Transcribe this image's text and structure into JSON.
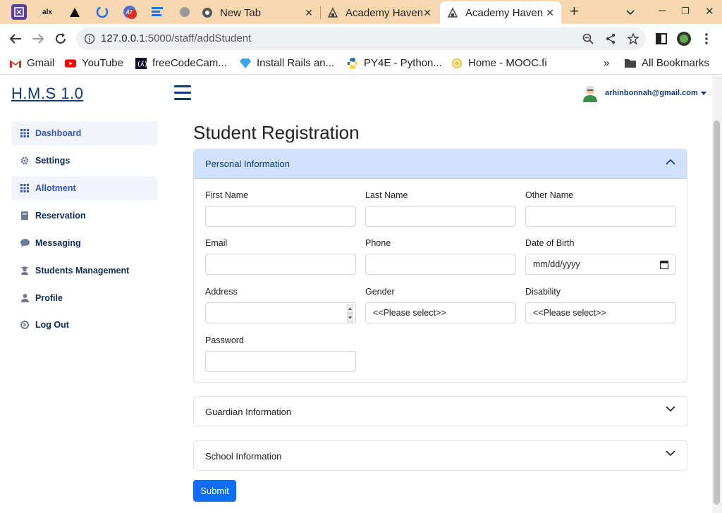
{
  "browser": {
    "tabs": [
      {
        "title": "New Tab"
      },
      {
        "title": "Academy Haven"
      },
      {
        "title": "Academy Haven"
      }
    ],
    "pinned_badge": "47",
    "url_host": "127.0.0.1",
    "url_rest": ":5000/staff/addStudent",
    "bookmarks": [
      "Gmail",
      "YouTube",
      "freeCodeCam...",
      "Install Rails an...",
      "PY4E - Python...",
      "Home - MOOC.fi"
    ],
    "overflow": "»",
    "all_bookmarks": "All Bookmarks"
  },
  "app": {
    "brand": "H.M.S 1.0",
    "user_email": "arhinbonnah@gmail.com",
    "sidebar": [
      {
        "label": "Dashboard",
        "icon": "grid-icon"
      },
      {
        "label": "Settings",
        "icon": "gear-icon"
      },
      {
        "label": "Allotment",
        "icon": "grid-icon"
      },
      {
        "label": "Reservation",
        "icon": "book-icon"
      },
      {
        "label": "Messaging",
        "icon": "chat-icon"
      },
      {
        "label": "Students Management",
        "icon": "student-icon"
      },
      {
        "label": "Profile",
        "icon": "user-icon"
      },
      {
        "label": "Log Out",
        "icon": "logout-icon"
      }
    ]
  },
  "form": {
    "title": "Student Registration",
    "sections": {
      "personal": "Personal Information",
      "guardian": "Guardian Information",
      "school": "School Information"
    },
    "fields": {
      "first_name": "First Name",
      "last_name": "Last Name",
      "other_name": "Other Name",
      "email": "Email",
      "phone": "Phone",
      "dob": "Date of Birth",
      "dob_placeholder": "mm/dd/yyyy",
      "address": "Address",
      "gender": "Gender",
      "gender_value": "<<Please select>>",
      "disability": "Disability",
      "disability_value": "<<Please select>>",
      "password": "Password"
    },
    "submit": "Submit"
  },
  "colors": {
    "tabstrip": "#f6d8b0",
    "brand": "#0d3b7c",
    "accordion_open": "#cfe2ff",
    "primary": "#0d6efd"
  }
}
